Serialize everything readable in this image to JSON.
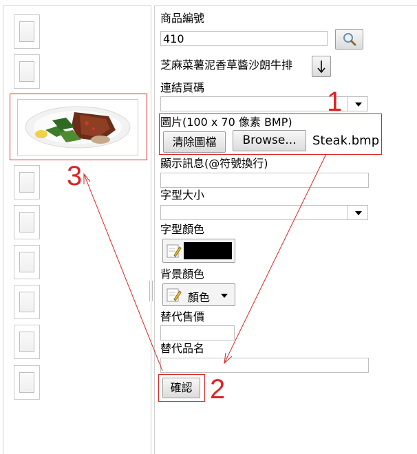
{
  "form": {
    "product_id_label": "商品編號",
    "product_id_value": "410",
    "product_name": "芝麻菜薯泥香草醬沙朗牛排",
    "link_page_label": "連結頁碼",
    "picture_label": "圖片(100 x 70 像素 BMP)",
    "clear_image_label": "清除圖檔",
    "browse_label": "Browse...",
    "file_name": "Steak.bmp",
    "display_message_label": "顯示訊息(@符號換行)",
    "font_size_label": "字型大小",
    "font_color_label": "字型顏色",
    "bg_color_label": "背景顏色",
    "bg_color_button_label": "顏色",
    "alt_price_label": "替代售價",
    "alt_name_label": "替代品名",
    "confirm_label": "確認"
  },
  "annotations": {
    "step1": "1",
    "step2": "2",
    "step3": "3"
  },
  "colors": {
    "annotation": "#dd2222",
    "font_color_swatch": "#000000"
  },
  "icons": {
    "search": "magnifier-icon",
    "down_arrow": "arrow-down-icon",
    "palette": "color-palette-icon"
  }
}
